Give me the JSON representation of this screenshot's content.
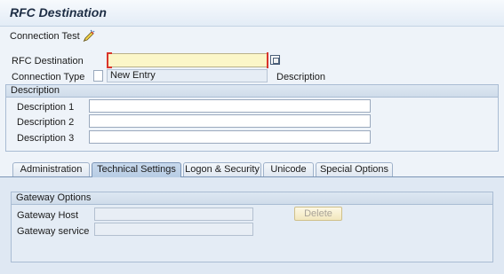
{
  "window": {
    "title": "RFC Destination"
  },
  "toolbar": {
    "connection_test_label": "Connection Test"
  },
  "header": {
    "rfc_destination_label": "RFC Destination",
    "rfc_destination_value": "",
    "connection_type_label": "Connection Type",
    "connection_type_value": "",
    "connection_type_display": "New Entry",
    "description_label": "Description"
  },
  "description_group": {
    "title": "Description",
    "fields": [
      {
        "label": "Description 1",
        "value": ""
      },
      {
        "label": "Description 2",
        "value": ""
      },
      {
        "label": "Description 3",
        "value": ""
      }
    ]
  },
  "tabs": [
    {
      "label": "Administration",
      "active": false
    },
    {
      "label": "Technical Settings",
      "active": true
    },
    {
      "label": "Logon & Security",
      "active": false
    },
    {
      "label": "Unicode",
      "active": false
    },
    {
      "label": "Special Options",
      "active": false
    }
  ],
  "gateway_group": {
    "title": "Gateway Options",
    "host_label": "Gateway Host",
    "host_value": "",
    "service_label": "Gateway service",
    "service_value": "",
    "delete_label": "Delete"
  },
  "icons": {
    "connection_test": "pencil-icon",
    "value_help": "value-help-icon"
  },
  "colors": {
    "required_field": "#fbf6c8",
    "required_marker": "#d9342b",
    "active_tab": "#b7cce4"
  }
}
